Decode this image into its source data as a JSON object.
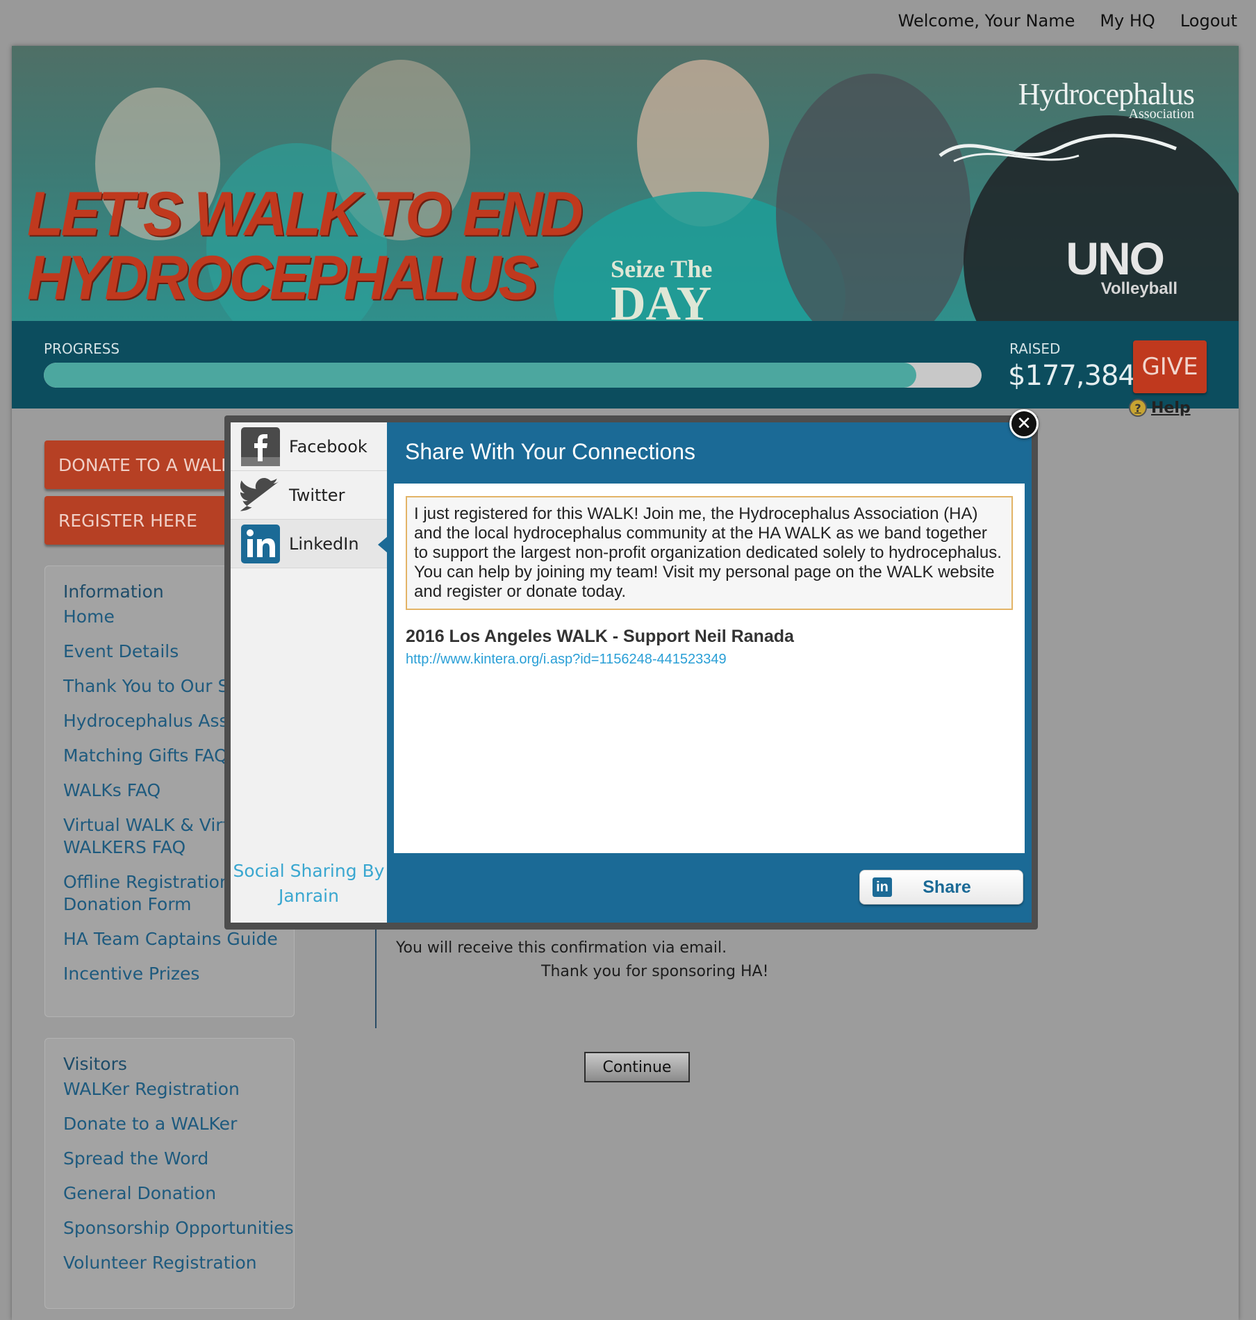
{
  "topnav": {
    "welcome": "Welcome, Your Name",
    "myhq": "My HQ",
    "logout": "Logout"
  },
  "hero": {
    "title_line1": "LET'S WALK TO END",
    "title_line2": "HYDROCEPHALUS",
    "logo_name": "Hydrocephalus",
    "logo_sub": "Association",
    "shirt_line1": "Seize The",
    "shirt_line2": "DAY",
    "uno": "UNO",
    "uno_sub": "Volleyball"
  },
  "progress": {
    "label": "PROGRESS",
    "fraction": 0.93,
    "raised_label": "RAISED",
    "raised_value": "$177,384",
    "give_label": "GIVE"
  },
  "buttons": {
    "donate": "DONATE TO A WALKER",
    "register": "REGISTER HERE"
  },
  "info_nav": {
    "heading": "Information",
    "items": [
      "Home",
      "Event Details",
      "Thank You to Our Sponsors",
      "Hydrocephalus Association",
      "Matching Gifts FAQ",
      "WALKs FAQ",
      "Virtual WALK & Virtual WALKERS FAQ",
      "Offline Registration & Donation Form",
      "HA Team Captains Guide",
      "Incentive Prizes"
    ]
  },
  "visitors_nav": {
    "heading": "Visitors",
    "items": [
      "WALKer Registration",
      "Donate to a WALKer",
      "Spread the Word",
      "General Donation",
      "Sponsorship Opportunities",
      "Volunteer Registration"
    ]
  },
  "help": {
    "label": "Help"
  },
  "confirmation": {
    "email_note": "You will receive this confirmation via email.",
    "thanks": "Thank you for sponsoring HA!",
    "continue_label": "Continue"
  },
  "modal": {
    "networks": [
      {
        "name": "Facebook",
        "icon": "facebook-icon"
      },
      {
        "name": "Twitter",
        "icon": "twitter-icon"
      },
      {
        "name": "LinkedIn",
        "icon": "linkedin-icon"
      }
    ],
    "active_network": "LinkedIn",
    "powered_by": "Social Sharing By Janrain",
    "title": "Share With Your Connections",
    "message": "I just registered for this WALK! Join me, the Hydrocephalus Association (HA) and the local hydrocephalus community at the HA WALK as we band together to support the largest non-profit organization dedicated solely to hydrocephalus. You can help by joining my team! Visit my personal page on the WALK website and register or donate today.",
    "link_title": "2016 Los Angeles WALK - Support Neil Ranada",
    "link_url": "http://www.kintera.org/i.asp?id=1156248-441523349",
    "share_label": "Share",
    "close_symbol": "✕"
  },
  "colors": {
    "accent_orange": "#b64024",
    "teal_strip": "#0c4d5e",
    "progress_fill": "#4ca79f",
    "modal_blue": "#1b6a96",
    "link_blue": "#2a9fd6"
  }
}
